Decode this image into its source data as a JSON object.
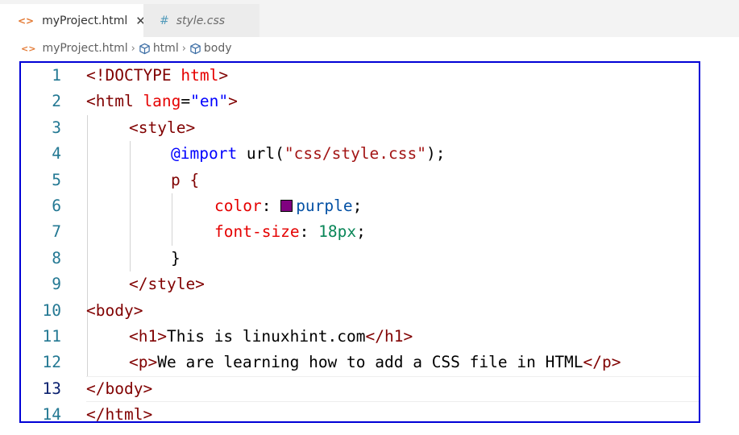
{
  "tabs": [
    {
      "icon": "<>",
      "label": "myProject.html",
      "close": "✕"
    },
    {
      "icon": "#",
      "label": "style.css"
    }
  ],
  "breadcrumb": {
    "file_icon": "<>",
    "file": "myProject.html",
    "items": [
      "html",
      "body"
    ]
  },
  "editor": {
    "line_numbers": [
      "1",
      "2",
      "3",
      "4",
      "5",
      "6",
      "7",
      "8",
      "9",
      "10",
      "11",
      "12",
      "13",
      "14"
    ],
    "current_line": "13",
    "swatch_color": "#800080",
    "tokens": {
      "l1_a": "<!DOCTYPE",
      "l1_b": " html",
      "l1_c": ">",
      "l2_a": "<html",
      "l2_b": " lang",
      "l2_c": "=",
      "l2_d": "\"en\"",
      "l2_e": ">",
      "l3": "<style>",
      "l4_a": "@import",
      "l4_b": " url(",
      "l4_c": "\"css/style.css\"",
      "l4_d": ");",
      "l5": "p {",
      "l6_a": "color",
      "l6_b": ": ",
      "l6_c": "purple",
      "l6_d": ";",
      "l7_a": "font-size",
      "l7_b": ": ",
      "l7_c": "18px",
      "l7_d": ";",
      "l8": "}",
      "l9": "</style>",
      "l10": "<body>",
      "l11_a": "<h1>",
      "l11_b": "This is linuxhint.com",
      "l11_c": "</h1>",
      "l12_a": "<p>",
      "l12_b": "We are learning how to add a CSS file in HTML",
      "l12_c": "</p>",
      "l13": "</body>",
      "l14": "</html>"
    }
  }
}
